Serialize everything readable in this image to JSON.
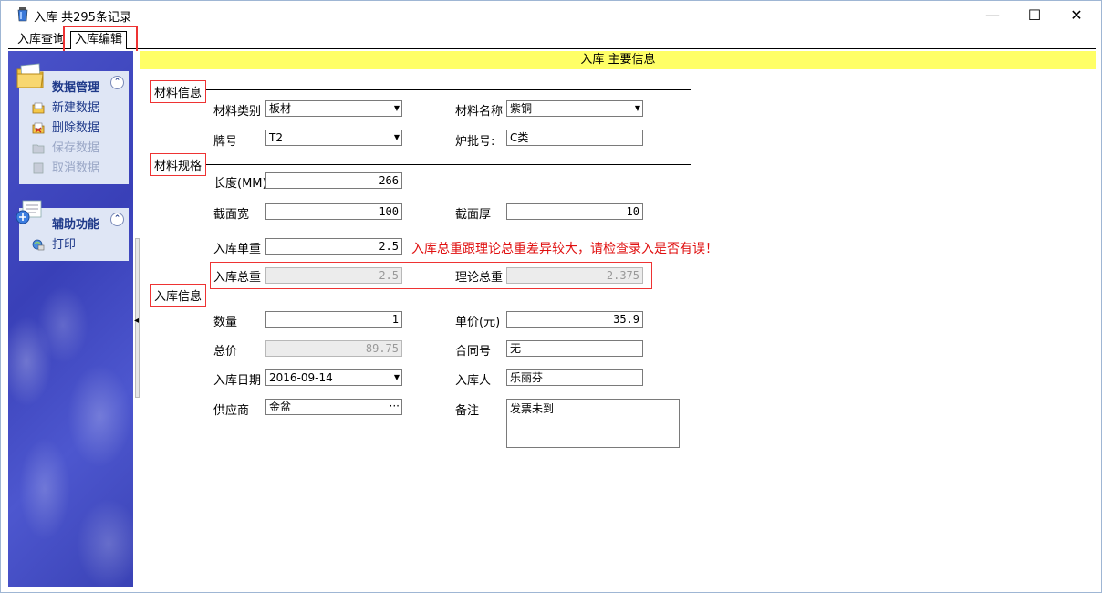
{
  "window": {
    "title": "入库 共295条记录",
    "minimize": "—",
    "maximize": "☐",
    "close": "✕"
  },
  "tabs": {
    "query": "入库查询",
    "edit": "入库编辑"
  },
  "sidebar": {
    "data_panel": {
      "title": "数据管理",
      "collapse": "⌃",
      "items": [
        {
          "label": "新建数据",
          "enabled": true
        },
        {
          "label": "删除数据",
          "enabled": true
        },
        {
          "label": "保存数据",
          "enabled": false
        },
        {
          "label": "取消数据",
          "enabled": false
        }
      ]
    },
    "aux_panel": {
      "title": "辅助功能",
      "collapse": "⌃",
      "items": [
        {
          "label": "打印"
        }
      ]
    }
  },
  "header": {
    "title": "入库 主要信息"
  },
  "sections": {
    "material_info": "材料信息",
    "material_spec": "材料规格",
    "stock_info": "入库信息"
  },
  "form": {
    "material_type": {
      "label": "材料类别",
      "value": "板材"
    },
    "material_name": {
      "label": "材料名称",
      "value": "紫铜"
    },
    "grade": {
      "label": "牌号",
      "value": "T2"
    },
    "batch_no": {
      "label": "炉批号:",
      "value": "C类"
    },
    "length": {
      "label": "长度(MM)",
      "value": "266"
    },
    "width": {
      "label": "截面宽",
      "value": "100"
    },
    "thickness": {
      "label": "截面厚",
      "value": "10"
    },
    "unit_weight": {
      "label": "入库单重",
      "value": "2.5"
    },
    "warning": "入库总重跟理论总重差异较大，请检查录入是否有误！",
    "total_weight": {
      "label": "入库总重",
      "value": "2.5"
    },
    "theory_weight": {
      "label": "理论总重",
      "value": "2.375"
    },
    "quantity": {
      "label": "数量",
      "value": "1"
    },
    "unit_price": {
      "label": "单价(元)",
      "value": "35.9"
    },
    "total_price": {
      "label": "总价",
      "value": "89.75"
    },
    "contract_no": {
      "label": "合同号",
      "value": "无"
    },
    "stock_date": {
      "label": "入库日期",
      "value": "2016-09-14"
    },
    "stock_person": {
      "label": "入库人",
      "value": "乐丽芬"
    },
    "supplier": {
      "label": "供应商",
      "value": "金盆"
    },
    "remark": {
      "label": "备注",
      "value": "发票未到"
    }
  },
  "colors": {
    "highlight_red": "#e33333",
    "header_yellow": "#ffff66",
    "sidebar_blue": "#4048c0",
    "panel_text": "#1f3a8a"
  }
}
